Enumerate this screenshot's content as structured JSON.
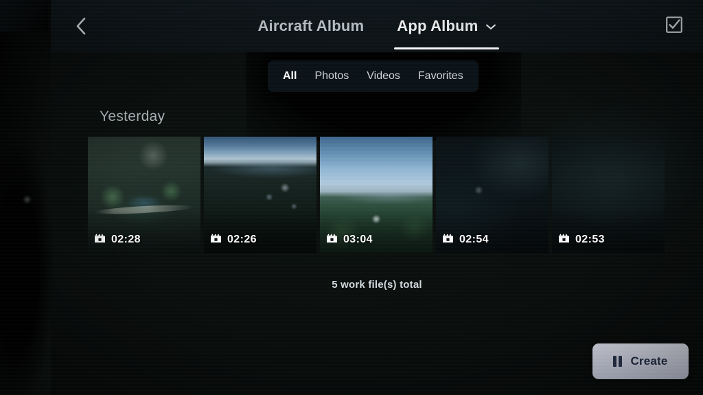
{
  "topbar": {
    "back_icon": "chevron-left-icon",
    "select_icon": "checkbox-checked-icon",
    "tabs": [
      {
        "label": "Aircraft Album",
        "active": false,
        "has_chevron": false
      },
      {
        "label": "App Album",
        "active": true,
        "has_chevron": true
      }
    ]
  },
  "filters": {
    "items": [
      {
        "label": "All",
        "active": true
      },
      {
        "label": "Photos",
        "active": false
      },
      {
        "label": "Videos",
        "active": false
      },
      {
        "label": "Favorites",
        "active": false
      }
    ]
  },
  "gallery": {
    "section_title": "Yesterday",
    "total_text": "5 work file(s) total",
    "items": [
      {
        "duration": "02:28",
        "badge_icon": "video-clip-icon"
      },
      {
        "duration": "02:26",
        "badge_icon": "video-clip-icon"
      },
      {
        "duration": "03:04",
        "badge_icon": "video-clip-icon"
      },
      {
        "duration": "02:54",
        "badge_icon": "video-clip-icon"
      },
      {
        "duration": "02:53",
        "badge_icon": "video-clip-icon"
      }
    ]
  },
  "footer": {
    "create_label": "Create",
    "create_icon": "clips-bars-icon"
  },
  "colors": {
    "topbar_bg": "#0e1519",
    "surface_bg": "#0a0f0d",
    "accent_text": "#ffffff",
    "muted_text": "#aeb7bc",
    "create_bg": "#d8dcec",
    "create_text": "#25304a"
  }
}
